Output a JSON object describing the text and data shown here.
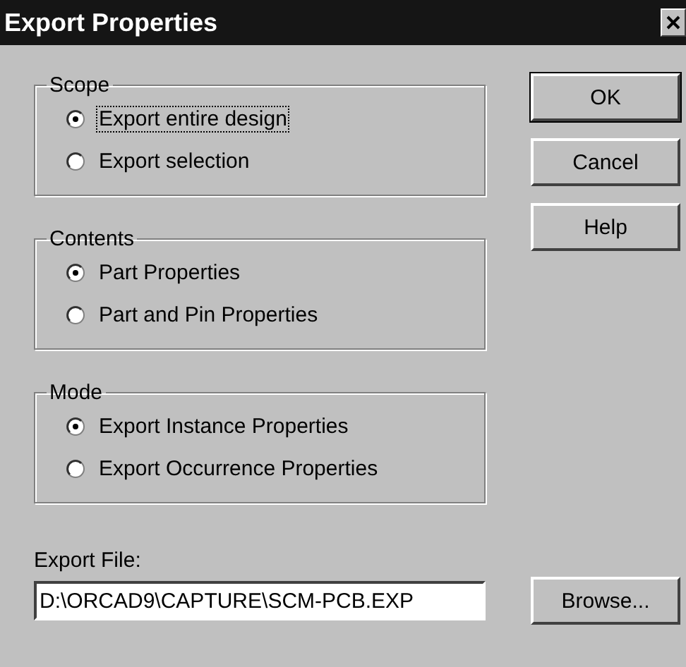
{
  "window": {
    "title": "Export Properties"
  },
  "groups": [
    {
      "title": "Scope",
      "options": [
        {
          "label": "Export entire design",
          "selected": true,
          "focused": true
        },
        {
          "label": "Export selection",
          "selected": false,
          "focused": false
        }
      ]
    },
    {
      "title": "Contents",
      "options": [
        {
          "label": "Part Properties",
          "selected": true,
          "focused": false
        },
        {
          "label": "Part and Pin Properties",
          "selected": false,
          "focused": false
        }
      ]
    },
    {
      "title": "Mode",
      "options": [
        {
          "label": "Export Instance Properties",
          "selected": true,
          "focused": false
        },
        {
          "label": "Export Occurrence Properties",
          "selected": false,
          "focused": false
        }
      ]
    }
  ],
  "buttons": [
    {
      "label": "OK",
      "default": true
    },
    {
      "label": "Cancel",
      "default": false
    },
    {
      "label": "Help",
      "default": false
    }
  ],
  "export_file": {
    "label": "Export File:",
    "value": "D:\\ORCAD9\\CAPTURE\\SCM-PCB.EXP"
  },
  "browse_button": {
    "label": "Browse..."
  }
}
